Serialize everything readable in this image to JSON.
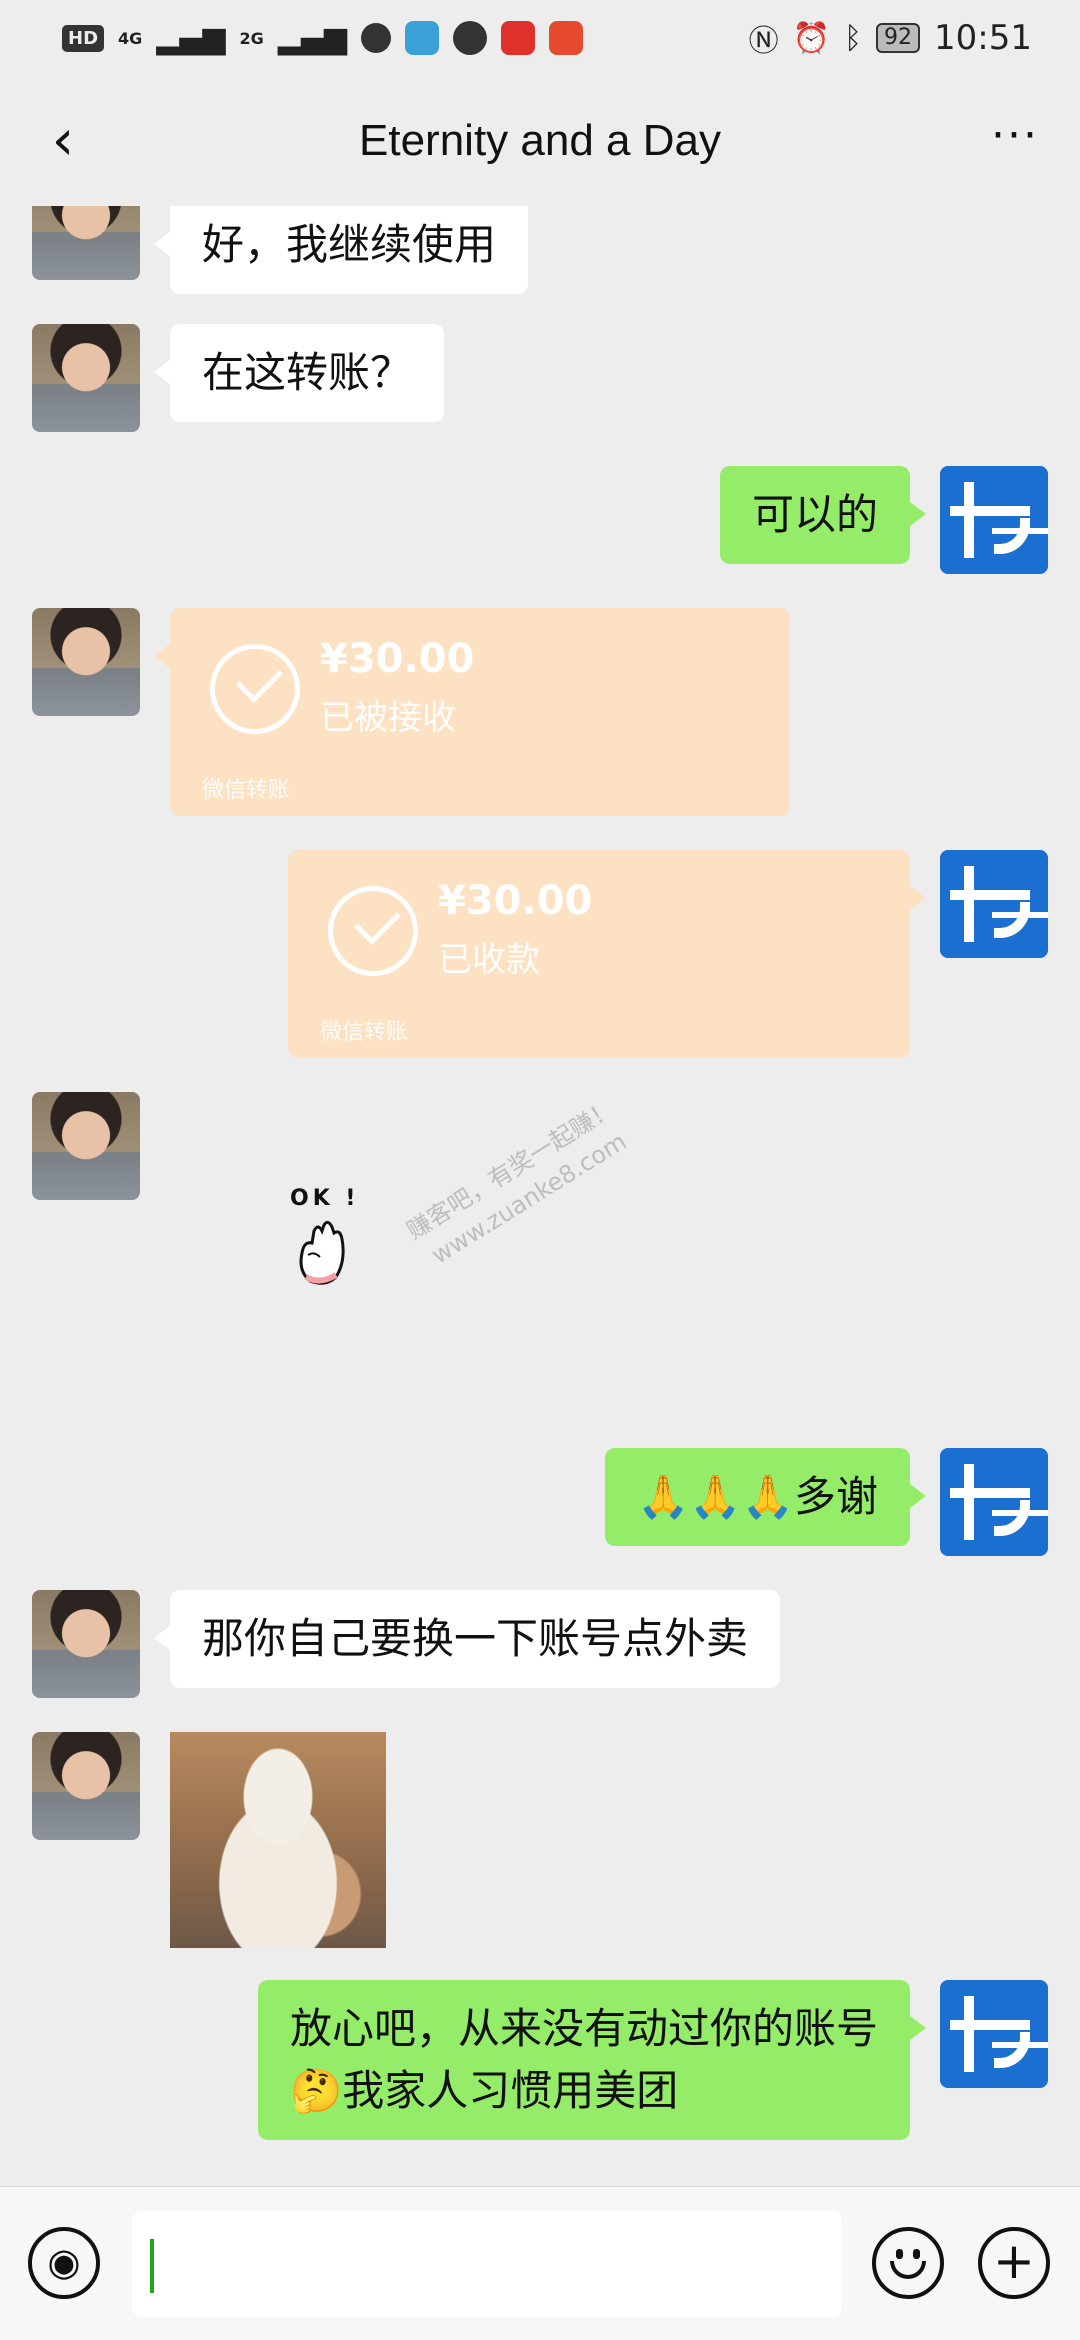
{
  "status_bar": {
    "tags": [
      "HD",
      "4G",
      "2G"
    ],
    "battery": "92",
    "time": "10:51"
  },
  "header": {
    "back_glyph": "‹",
    "title": "Eternity and a Day",
    "more_glyph": "···"
  },
  "messages": [
    {
      "side": "in",
      "type": "text",
      "text": "好，我继续使用"
    },
    {
      "side": "in",
      "type": "text",
      "text": "在这转账？"
    },
    {
      "side": "out",
      "type": "text",
      "text": "可以的"
    },
    {
      "side": "in",
      "type": "transfer",
      "amount": "¥30.00",
      "status": "已被接收",
      "source": "微信转账"
    },
    {
      "side": "out",
      "type": "transfer",
      "amount": "¥30.00",
      "status": "已收款",
      "source": "微信转账"
    },
    {
      "side": "in",
      "type": "sticker",
      "text": "OK !"
    },
    {
      "side": "out",
      "type": "text",
      "text": "🙏🙏🙏多谢"
    },
    {
      "side": "in",
      "type": "text",
      "text": "那你自己要换一下账号点外卖"
    },
    {
      "side": "in",
      "type": "image",
      "icon": "shiba-dog-image"
    },
    {
      "side": "out",
      "type": "text",
      "text": "放心吧，从来没有动过你的账号\n🤔我家人习惯用美团"
    }
  ],
  "watermark": {
    "line1": "赚客吧，有奖一起赚！",
    "line2": "www.zuanke8.com"
  },
  "input_bar": {
    "voice_glyph": "◉",
    "plus_glyph": "+"
  },
  "colors": {
    "background": "#ededed",
    "incoming_bubble": "#ffffff",
    "outgoing_bubble": "#95ec69",
    "transfer_card": "#fde1c3",
    "self_avatar": "#1b6fd1"
  }
}
